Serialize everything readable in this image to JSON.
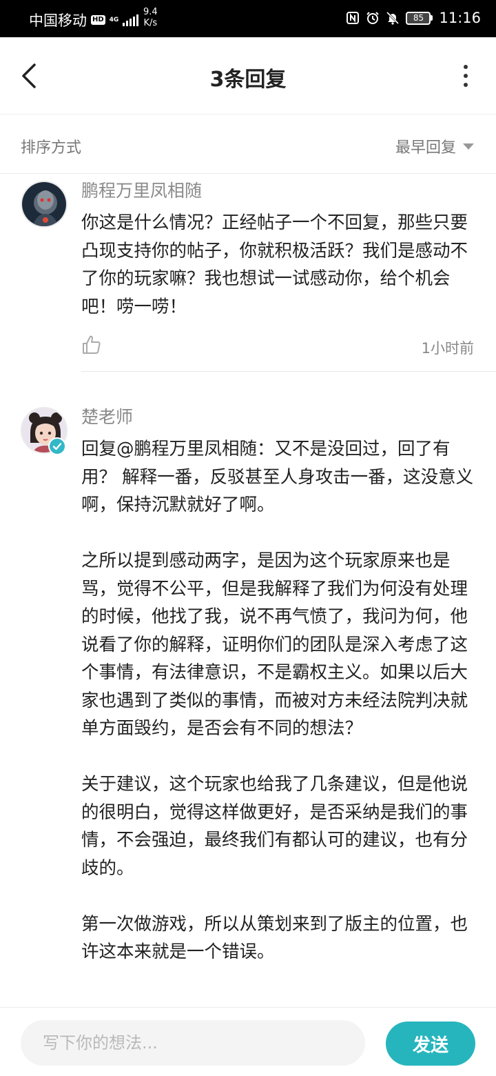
{
  "status_bar": {
    "carrier": "中国移动",
    "hd_badge": "HD",
    "network_gen": "4G",
    "net_speed_value": "9.4",
    "net_speed_unit": "K/s",
    "battery_level": "85",
    "time": "11:16",
    "icons": [
      "nfc-icon",
      "alarm-icon",
      "mute-bell-icon",
      "battery-icon"
    ]
  },
  "nav": {
    "title": "3条回复",
    "back_icon": "chevron-left-icon",
    "more_icon": "more-vertical-icon"
  },
  "sort": {
    "label": "排序方式",
    "selected": "最早回复"
  },
  "comments": [
    {
      "author": "鹏程万里凤相随",
      "paragraphs": [
        "你这是什么情况？正经帖子一个不回复，那些只要凸现支持你的帖子，你就积极活跃？我们是感动不了你的玩家嘛？我也想试一试感动你，给个机会吧！唠一唠！"
      ],
      "time": "1小时前",
      "like_icon": "thumbs-up-icon"
    },
    {
      "author": "楚老师",
      "verified": true,
      "reply_prefix": "回复",
      "reply_to": "@鹏程万里凤相随",
      "reply_sep": "：",
      "first_text": "又不是没回过，回了有用？ 解释一番，反驳甚至人身攻击一番，这没意义啊，保持沉默就好了啊。",
      "paragraphs": [
        "之所以提到感动两字，是因为这个玩家原来也是骂，觉得不公平，但是我解释了我们为何没有处理的时候，他找了我，说不再气愤了，我问为何，他说看了你的解释，证明你们的团队是深入考虑了这个事情，有法律意识，不是霸权主义。如果以后大家也遇到了类似的事情，而被对方未经法院判决就单方面毁约，是否会有不同的想法？",
        "关于建议，这个玩家也给我了几条建议，但是他说的很明白，觉得这样做更好，是否采纳是我们的事情，不会强迫，最终我们有都认可的建议，也有分歧的。",
        "第一次做游戏，所以从策划来到了版主的位置，也许这本来就是一个错误。"
      ]
    }
  ],
  "composer": {
    "placeholder": "写下你的想法...",
    "send_label": "发送"
  },
  "colors": {
    "accent": "#27b5bd",
    "verified_badge": "#33b8c8",
    "status_bar_bg": "#000000"
  }
}
